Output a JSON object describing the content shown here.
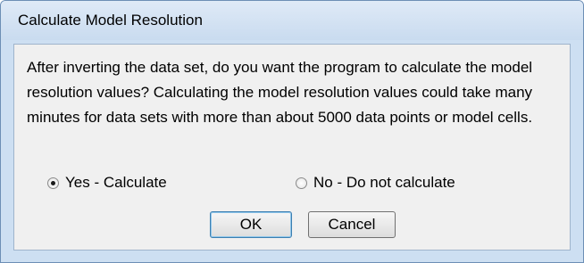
{
  "window": {
    "title": "Calculate Model Resolution"
  },
  "dialog": {
    "message": "After inverting the data set, do you want the program to calculate the model resolution values? Calculating the model resolution values could take many minutes for data sets with more than about 5000 data points or model cells.",
    "options": [
      {
        "label": "Yes - Calculate",
        "selected": true
      },
      {
        "label": "No - Do not calculate",
        "selected": false
      }
    ],
    "ok_label": "OK",
    "cancel_label": "Cancel"
  }
}
